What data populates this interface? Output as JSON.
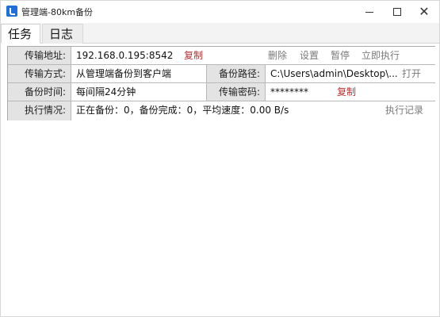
{
  "window": {
    "title": "管理端-80km备份",
    "minimize_glyph": "",
    "maximize_glyph": "",
    "close_glyph": "✕"
  },
  "tabs": [
    {
      "label": "任务",
      "active": true
    },
    {
      "label": "日志",
      "active": false
    }
  ],
  "task": {
    "row1": {
      "label": "传输地址:",
      "value": "192.168.0.195:8542",
      "copy": "复制",
      "actions": [
        "删除",
        "设置",
        "暂停",
        "立即执行"
      ]
    },
    "row2": {
      "label": "传输方式:",
      "value": "从管理端备份到客户端",
      "label2": "备份路径:",
      "value2": "C:\\Users\\admin\\Desktop\\...",
      "open": "打开"
    },
    "row3": {
      "label": "备份时间:",
      "value": "每间隔24分钟",
      "label2": "传输密码:",
      "value2": "********",
      "copy": "复制"
    },
    "row4": {
      "label": "执行情况:",
      "value": "正在备份：0，备份完成：0，平均速度：0.00 B/s",
      "history": "执行记录"
    }
  },
  "colors": {
    "accent_red": "#b83232",
    "label_bg": "#e3e3e3",
    "action_gray": "#7a7a7a",
    "app_icon": "#1e6fd8"
  },
  "icons": {
    "app": "app-icon",
    "minimize": "minimize-icon",
    "maximize": "maximize-icon",
    "close": "close-icon"
  }
}
